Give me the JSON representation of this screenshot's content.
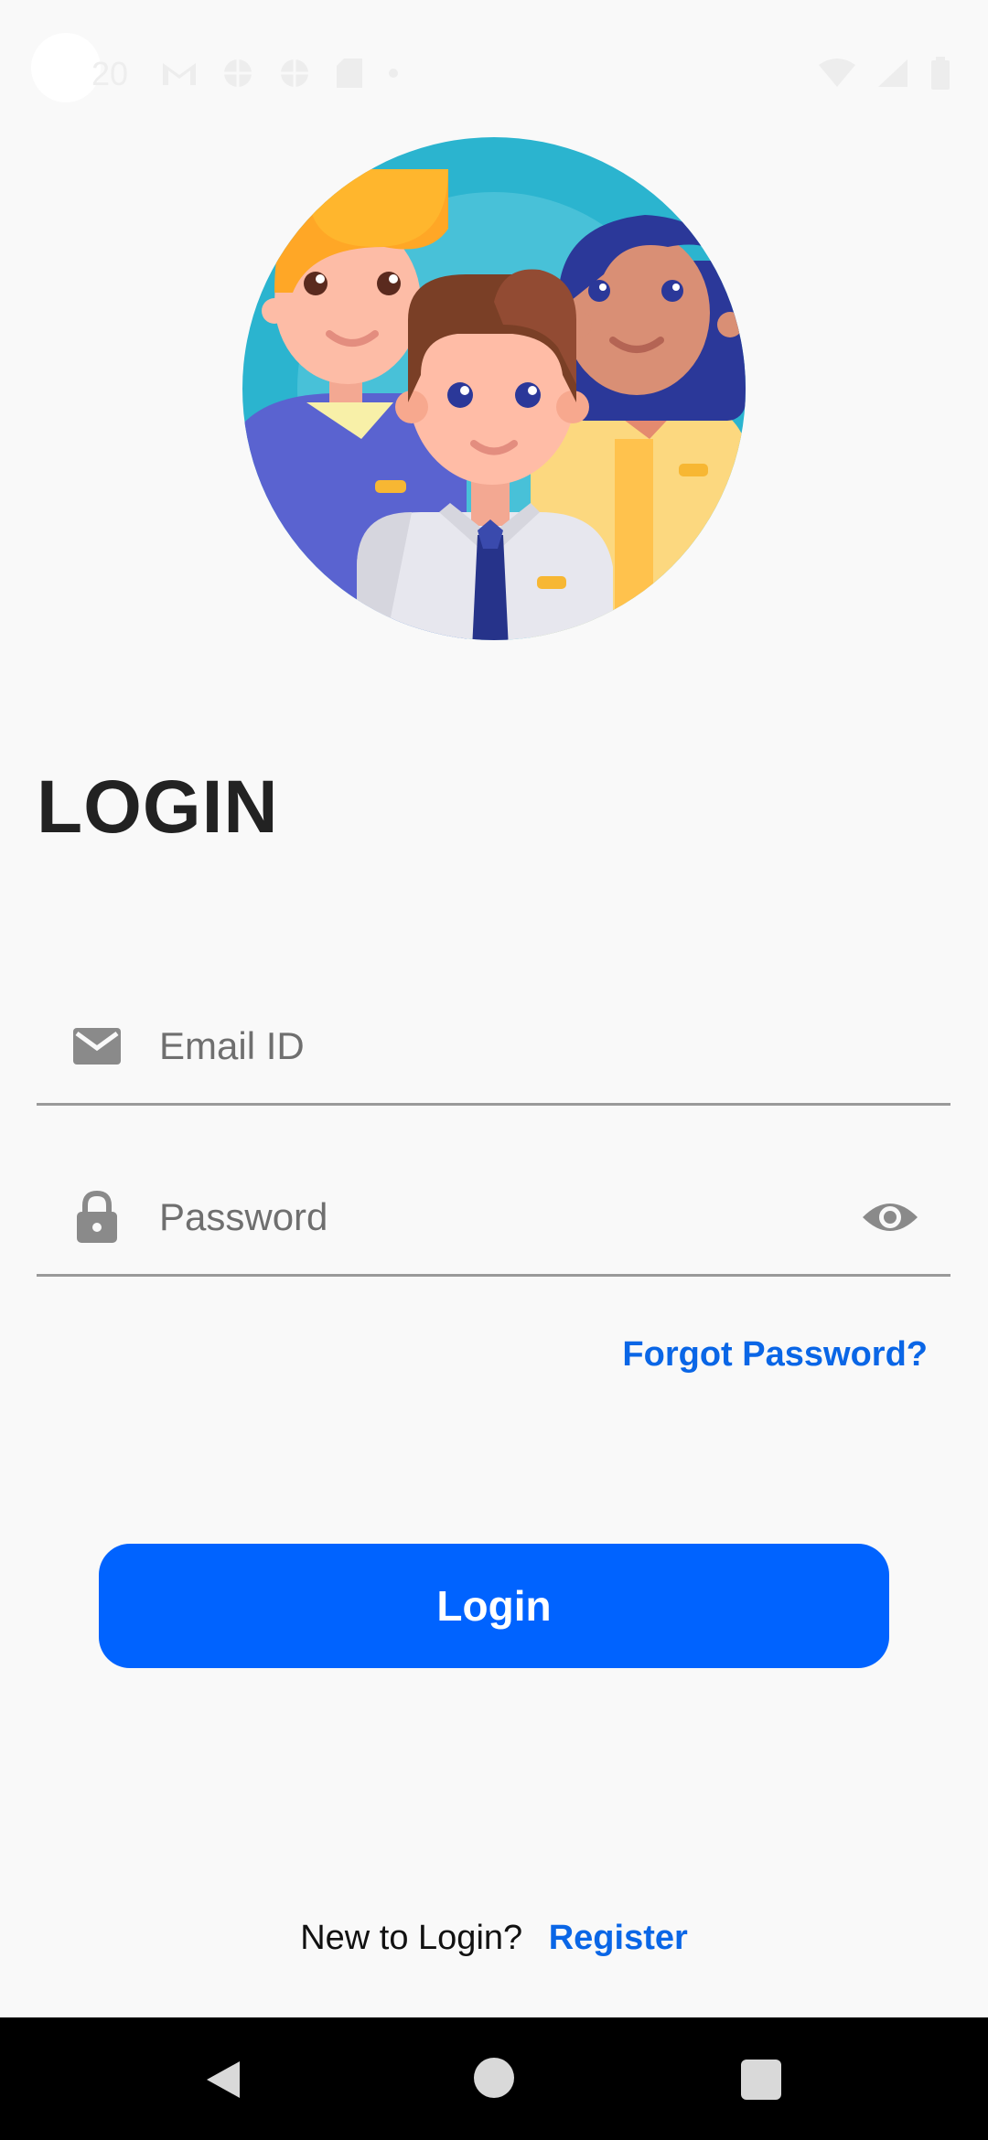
{
  "status_bar": {
    "time": "20",
    "left_icons": [
      "gmail-icon",
      "globe-icon",
      "globe-icon",
      "sd-card-icon",
      "dot-icon"
    ],
    "right_icons": [
      "wifi-icon",
      "signal-icon",
      "battery-icon"
    ]
  },
  "login": {
    "title": "LOGIN",
    "email": {
      "placeholder": "Email ID",
      "value": "",
      "icon": "email-icon"
    },
    "password": {
      "placeholder": "Password",
      "value": "",
      "icon": "lock-icon",
      "toggle_icon": "eye-icon"
    },
    "forgot_label": "Forgot Password?",
    "button_label": "Login",
    "register_prompt": "New to Login?",
    "register_label": "Register"
  },
  "colors": {
    "background": "#f9f9f9",
    "accent": "#0063ff",
    "link": "#0a66e6",
    "title": "#222222",
    "icon_gray": "#8a8a8a"
  },
  "nav_bar": {
    "buttons": [
      "back-icon",
      "home-icon",
      "recents-icon"
    ]
  }
}
